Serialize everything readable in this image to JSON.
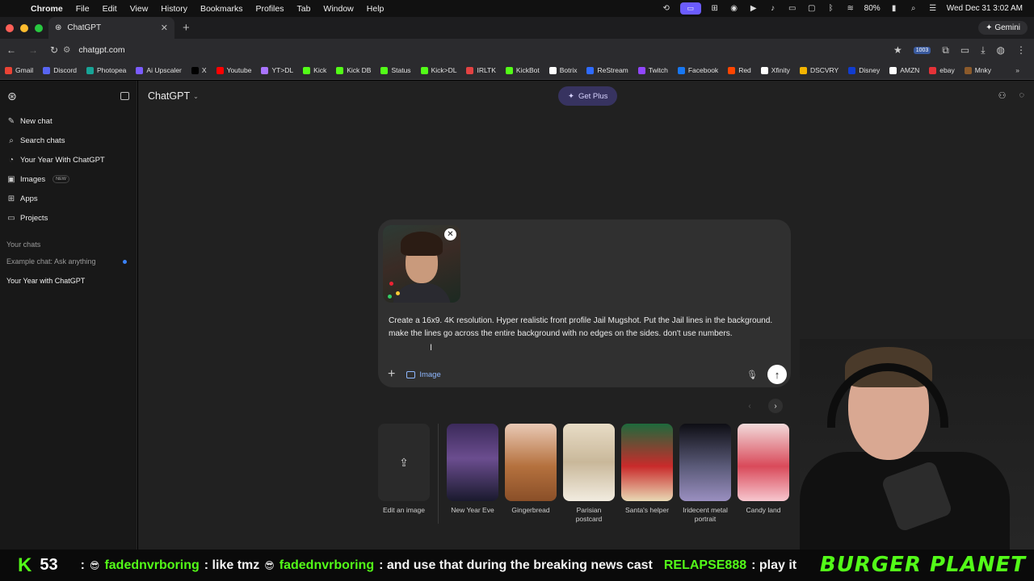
{
  "menubar": {
    "app": "Chrome",
    "items": [
      "File",
      "Edit",
      "View",
      "History",
      "Bookmarks",
      "Profiles",
      "Tab",
      "Window",
      "Help"
    ],
    "battery": "80%",
    "datetime": "Wed Dec 31  3:02 AM"
  },
  "browser": {
    "tab_title": "ChatGPT",
    "url": "chatgpt.com",
    "gemini": "Gemini",
    "ext_badge": "1003"
  },
  "bookmarks": [
    {
      "label": "Gmail",
      "color": "#ea4335"
    },
    {
      "label": "Discord",
      "color": "#5865f2"
    },
    {
      "label": "Photopea",
      "color": "#18a497"
    },
    {
      "label": "Ai Upscaler",
      "color": "#7b5cff"
    },
    {
      "label": "X",
      "color": "#000000"
    },
    {
      "label": "Youtube",
      "color": "#ff0000"
    },
    {
      "label": "YT>DL",
      "color": "#a974ff"
    },
    {
      "label": "Kick",
      "color": "#53fc18"
    },
    {
      "label": "Kick DB",
      "color": "#53fc18"
    },
    {
      "label": "Status",
      "color": "#53fc18"
    },
    {
      "label": "Kick>DL",
      "color": "#53fc18"
    },
    {
      "label": "IRLTK",
      "color": "#e34242"
    },
    {
      "label": "KickBot",
      "color": "#53fc18"
    },
    {
      "label": "Botrix",
      "color": "#ffffff"
    },
    {
      "label": "ReStream",
      "color": "#2f6bff"
    },
    {
      "label": "Twitch",
      "color": "#9146ff"
    },
    {
      "label": "Facebook",
      "color": "#1877f2"
    },
    {
      "label": "Red",
      "color": "#ff4500"
    },
    {
      "label": "Xfinity",
      "color": "#ffffff"
    },
    {
      "label": "DSCVRY",
      "color": "#f4b400"
    },
    {
      "label": "Disney",
      "color": "#113ccf"
    },
    {
      "label": "AMZN",
      "color": "#ffffff"
    },
    {
      "label": "ebay",
      "color": "#e53238"
    },
    {
      "label": "Mnky",
      "color": "#8b5a2b"
    }
  ],
  "sidebar": {
    "nav": [
      {
        "label": "New chat",
        "icon": "✎"
      },
      {
        "label": "Search chats",
        "icon": "⌕"
      },
      {
        "label": "Your Year With ChatGPT",
        "icon": "◔"
      },
      {
        "label": "Images",
        "icon": "▣",
        "badge": "NEW"
      },
      {
        "label": "Apps",
        "icon": "⊞"
      },
      {
        "label": "Projects",
        "icon": "▭"
      }
    ],
    "section_title": "Your chats",
    "chats": [
      {
        "label": "Example chat: Ask anything"
      },
      {
        "label": "Your Year with ChatGPT"
      }
    ]
  },
  "header": {
    "model": "ChatGPT",
    "get_plus": "Get Plus"
  },
  "composer": {
    "prompt": "Create a 16x9. 4K resolution. Hyper realistic front profile Jail Mugshot. Put the Jail lines in the background. make the lines go across the entire background with no edges on the sides. don't use numbers.",
    "image_tool": "Image"
  },
  "styles": [
    {
      "label": "Edit an image"
    },
    {
      "label": "New Year Eve",
      "bg": "linear-gradient(180deg,#3b2a5a 0%,#6b4d8f 45%,#1a1a2e 100%)"
    },
    {
      "label": "Gingerbread",
      "bg": "linear-gradient(180deg,#e9c9b5 0%,#b5713e 55%,#8a4f28 100%)"
    },
    {
      "label": "Parisian postcard",
      "bg": "linear-gradient(180deg,#e8dcc6 0%,#c9b89a 50%,#f2ece0 100%)"
    },
    {
      "label": "Santa's helper",
      "bg": "linear-gradient(180deg,#1e6a3c 0%,#c92b2b 55%,#e9d9b5 100%)"
    },
    {
      "label": "Iridecent metal portrait",
      "bg": "linear-gradient(180deg,#0e0e14 0%,#5a5a78 55%,#9a8fc0 100%)"
    },
    {
      "label": "Candy land",
      "bg": "linear-gradient(180deg,#f2dada 0%,#d94a5a 55%,#f7c7cf 100%)"
    }
  ],
  "ticker": {
    "count": "53",
    "messages": [
      {
        "user": "fadednvrboring",
        "text": ": like tmz"
      },
      {
        "user": "fadednvrboring",
        "text": ": and use that during the breaking news cast"
      },
      {
        "user": "RELAPSE888",
        "text": ": play it"
      }
    ],
    "brand": "BURGER PLANET"
  }
}
